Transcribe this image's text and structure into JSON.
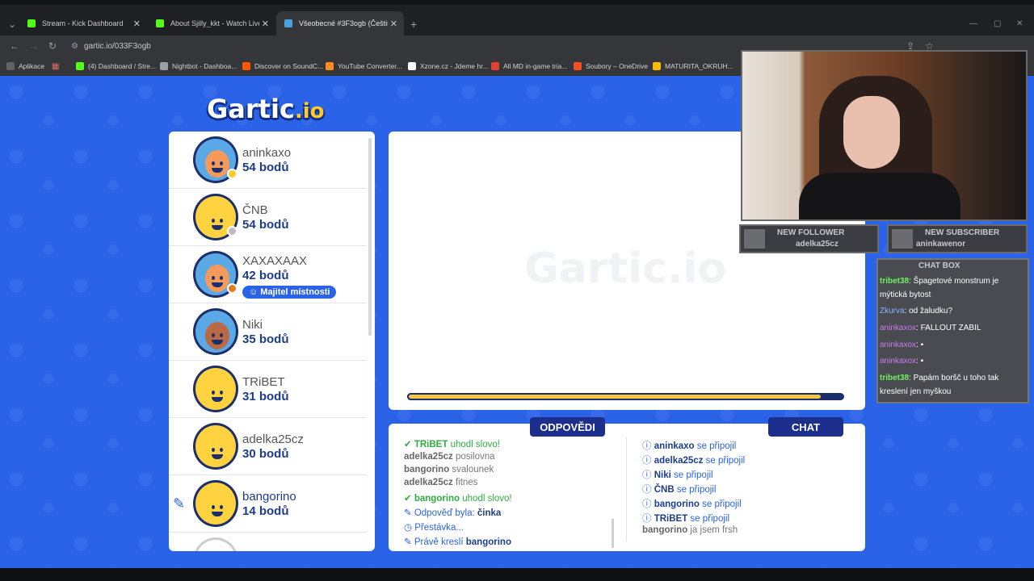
{
  "browser": {
    "tabs": [
      {
        "title": "Stream - Kick Dashboard",
        "color": "#53fc18"
      },
      {
        "title": "About Sjilly_kkt - Watch Live or",
        "color": "#53fc18"
      },
      {
        "title": "Všeobecné #3F3ogb (Čeština)",
        "color": "#4aa3df"
      }
    ],
    "url": "gartic.io/033F3ogb",
    "bookmarks": [
      {
        "label": "Aplikace",
        "color": "#5f6368"
      },
      {
        "label": "(4) Dashboard / Stre...",
        "color": "#53fc18"
      },
      {
        "label": "Nightbot - Dashboa...",
        "color": "#9aa0a6"
      },
      {
        "label": "Discover on SoundC...",
        "color": "#ff5500"
      },
      {
        "label": "YouTube Converter...",
        "color": "#ff8a1f"
      },
      {
        "label": "Xzone.cz - Jdeme hr...",
        "color": "#ffffff"
      },
      {
        "label": "All MD in-game tria...",
        "color": "#e0432f"
      },
      {
        "label": "Soubory – OneDrive",
        "color": "#f25022"
      },
      {
        "label": "MATURITA_OKRUH...",
        "color": "#fbbc04"
      }
    ]
  },
  "game": {
    "logo": "Gartic",
    "logo_suffix": ".io",
    "watermark": "Gartic.io",
    "timer_fraction": 0.95,
    "players": [
      {
        "name": "aninkaxo",
        "points": "54 bodů",
        "avatar": "blue",
        "status_color": "#ffc928"
      },
      {
        "name": "ČNB",
        "points": "54 bodů",
        "avatar": "yellow",
        "status_color": "#bdbdbd"
      },
      {
        "name": "XAXAXAAX",
        "points": "42 bodů",
        "avatar": "blue",
        "status_color": "#e87a1c",
        "badge": "Majitel místnosti"
      },
      {
        "name": "Niki",
        "points": "35 bodů",
        "avatar": "blue",
        "status_color": ""
      },
      {
        "name": "TRiBET",
        "points": "31 bodů",
        "avatar": "yellow",
        "status_color": ""
      },
      {
        "name": "adelka25cz",
        "points": "30 bodů",
        "avatar": "yellow",
        "status_color": ""
      },
      {
        "name": "bangorino",
        "points": "14 bodů",
        "avatar": "yellow",
        "status_color": "",
        "drawing": true
      }
    ],
    "answers_tab": "ODPOVĚDI",
    "chat_tab": "CHAT",
    "answers": [
      {
        "user": "TRiBET",
        "text": " uhodl slovo!",
        "type": "correct"
      },
      {
        "user": "adelka25cz",
        "text": " posilovna",
        "type": "guess"
      },
      {
        "user": "bangorino",
        "text": " svalounek",
        "type": "guess"
      },
      {
        "user": "adelka25cz",
        "text": " fitnes",
        "type": "guess"
      },
      {
        "user": "bangorino",
        "text": " uhodl slovo!",
        "type": "correct"
      },
      {
        "user": "Odpověď byla: ",
        "text": "činka",
        "type": "info"
      },
      {
        "user": "Přestávka...",
        "text": "",
        "type": "break"
      },
      {
        "user": "Právě kreslí ",
        "text": "bangorino",
        "type": "info"
      }
    ],
    "chat": [
      {
        "user": "aninkaxo",
        "text": " se připojil"
      },
      {
        "user": "adelka25cz",
        "text": " se připojil"
      },
      {
        "user": "Niki",
        "text": " se připojil"
      },
      {
        "user": "ČNB",
        "text": " se připojil"
      },
      {
        "user": "bangorino",
        "text": " se připojil"
      },
      {
        "user": "TRiBET",
        "text": " se připojil"
      },
      {
        "user": "bangorino",
        "text": " ja jsem frsh",
        "plain": true
      }
    ]
  },
  "overlay": {
    "new_follower_label": "NEW FOLLOWER",
    "new_follower_name": "adelka25cz",
    "new_subscriber_label": "NEW SUBSCRIBER",
    "new_subscriber_name": "aninkawenor",
    "chatbox_title": "CHAT BOX",
    "messages": [
      {
        "user": "tribet38",
        "text": ": Špagetové monstrum je mýtická bytost",
        "color": "#6df25e"
      },
      {
        "user": "Zkurva",
        "text": ": od žaludku?",
        "color": "#8ab4ff"
      },
      {
        "user": "aninkaxox",
        "text": ": FALLOUT ZABIL",
        "color": "#c97cf0"
      },
      {
        "user": "aninkaxox",
        "text": ":",
        "color": "#c97cf0"
      },
      {
        "user": "aninkaxox",
        "text": ":",
        "color": "#c97cf0"
      },
      {
        "user": "tribet38",
        "text": ": Papám boršč u toho tak kreslení jen myškou",
        "color": "#6df25e"
      }
    ]
  }
}
